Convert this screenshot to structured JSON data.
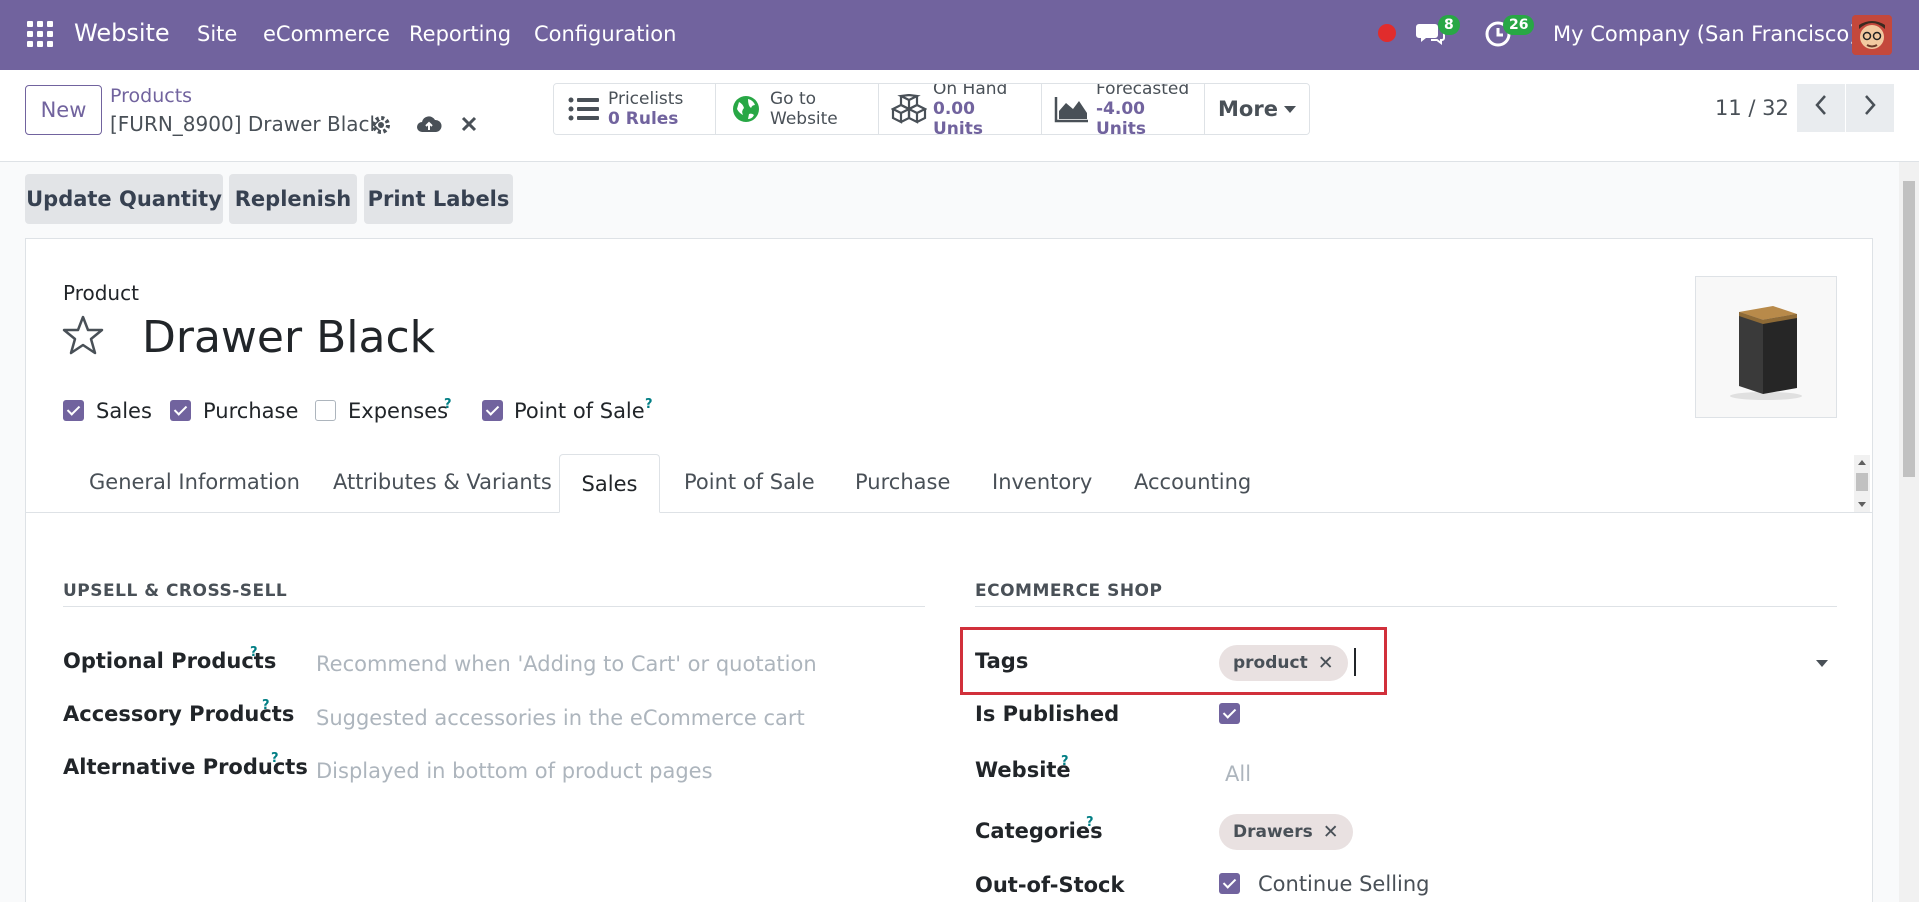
{
  "nav": {
    "app_name": "Website",
    "menu": [
      "Site",
      "eCommerce",
      "Reporting",
      "Configuration"
    ],
    "messages_count": "8",
    "activities_count": "26",
    "company": "My Company (San Francisco)"
  },
  "control": {
    "new_label": "New",
    "breadcrumb_parent": "Products",
    "record_name": "[FURN_8900] Drawer Black",
    "smart_buttons": {
      "pricelists": {
        "label": "Pricelists",
        "value": "0  Rules"
      },
      "website": {
        "label": "Go to",
        "value": "Website"
      },
      "on_hand": {
        "label": "On Hand",
        "value": "0.00 Units"
      },
      "forecasted": {
        "label": "Forecasted",
        "value": "-4.00 Units"
      },
      "more": "More"
    },
    "pager": "11 / 32"
  },
  "actions": [
    "Update Quantity",
    "Replenish",
    "Print Labels"
  ],
  "form": {
    "type_label": "Product",
    "product_name": "Drawer Black",
    "flags": [
      {
        "label": "Sales",
        "checked": true
      },
      {
        "label": "Purchase",
        "checked": true
      },
      {
        "label": "Expenses",
        "checked": false
      },
      {
        "label": "Point of Sale",
        "checked": true
      }
    ],
    "help_mark": "?"
  },
  "tabs": [
    "General Information",
    "Attributes & Variants",
    "Sales",
    "Point of Sale",
    "Purchase",
    "Inventory",
    "Accounting"
  ],
  "active_tab": "Sales",
  "upsell": {
    "title": "UPSELL & CROSS-SELL",
    "fields": [
      {
        "label": "Optional Products",
        "placeholder": "Recommend when 'Adding to Cart' or quotation"
      },
      {
        "label": "Accessory Products",
        "placeholder": "Suggested accessories in the eCommerce cart"
      },
      {
        "label": "Alternative Products",
        "placeholder": "Displayed in bottom of product pages"
      }
    ]
  },
  "ecommerce": {
    "title": "ECOMMERCE SHOP",
    "tags_label": "Tags",
    "tags": [
      "product"
    ],
    "published_label": "Is Published",
    "is_published": true,
    "website_label": "Website",
    "website_placeholder": "All",
    "categories_label": "Categories",
    "categories": [
      "Drawers"
    ],
    "out_of_stock_label": "Out-of-Stock",
    "continue_selling_label": "Continue Selling",
    "continue_selling": true
  },
  "colors": {
    "brand": "#71639e",
    "highlight": "#d1303b",
    "badge": "#28a745"
  },
  "remove_glyph": "✕"
}
